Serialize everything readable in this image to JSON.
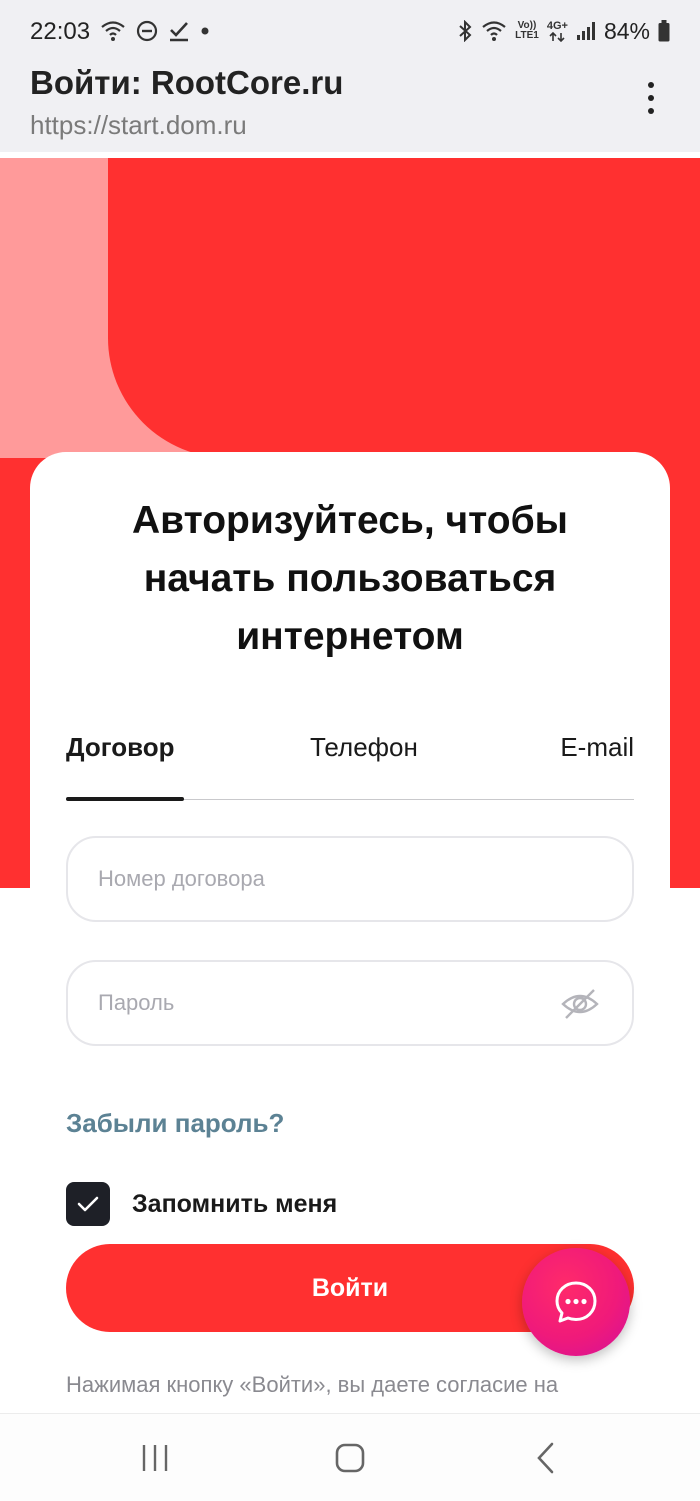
{
  "status_bar": {
    "time": "22:03",
    "battery": "84%",
    "left_icons": [
      "wifi-question-icon",
      "do-not-disturb-icon",
      "check-download-icon",
      "dot-icon"
    ],
    "right_icons": [
      "bluetooth-icon",
      "wifi-icon",
      "volte-icon",
      "4g-plus-icon",
      "signal-icon",
      "battery-icon"
    ],
    "volte_label_top": "Vo))",
    "volte_label_bottom": "LTE1",
    "net_label": "4G+"
  },
  "browser": {
    "title": "Войти: RootCore.ru",
    "url": "https://start.dom.ru",
    "menu_icon": "more-vertical-icon"
  },
  "card": {
    "title_line1": "Авторизуйтесь, чтобы",
    "title_line2": "начать пользоваться",
    "title_line3": "интернетом",
    "tabs": [
      {
        "label": "Договор",
        "active": true
      },
      {
        "label": "Телефон",
        "active": false
      },
      {
        "label": "E-mail",
        "active": false
      }
    ],
    "contract_placeholder": "Номер договора",
    "contract_value": "",
    "password_placeholder": "Пароль",
    "password_value": "",
    "eye_icon": "eye-off-icon",
    "forgot_label": "Забыли пароль?",
    "remember_label": "Запомнить меня",
    "remember_checked": true,
    "login_label": "Войти",
    "consent_text": "Нажимая кнопку «Войти», вы даете согласие на"
  },
  "chat": {
    "icon": "chat-bubble-icon"
  },
  "nav": {
    "icons": [
      "recent-apps-icon",
      "home-icon",
      "back-icon"
    ]
  },
  "colors": {
    "brand_red": "#ff3030",
    "pink": "#ff9a9a",
    "link": "#5c8294",
    "dark": "#1e2027",
    "fab": "#f01a7a"
  }
}
